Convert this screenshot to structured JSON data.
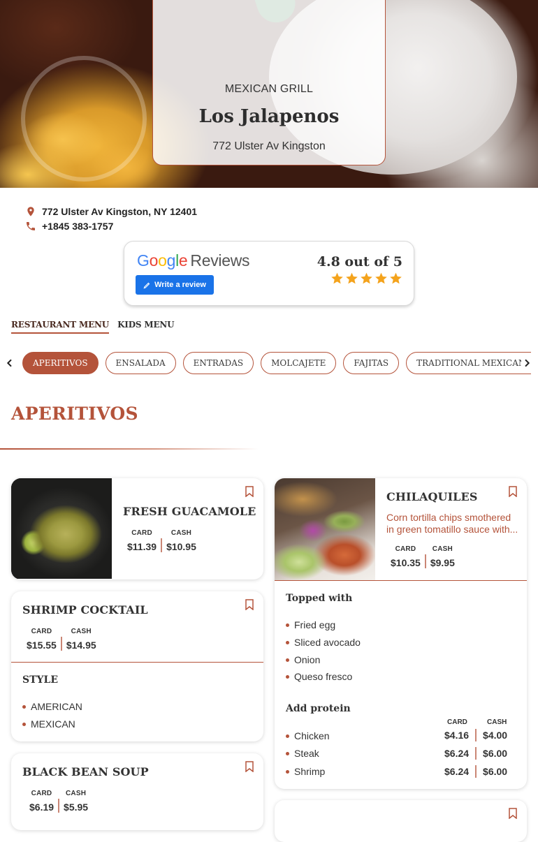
{
  "hero": {
    "subtitle": "MEXICAN GRILL",
    "title": "Los Jalapenos",
    "address": "772 Ulster Av Kingston",
    "address_glyph": ""
  },
  "contact": {
    "address": "772 Ulster Av Kingston, NY 12401",
    "phone": "+1845 383-1757"
  },
  "reviews": {
    "brand": "Google",
    "label": "Reviews",
    "button": "Write a review",
    "score": "4.8 out of 5",
    "stars": 5,
    "star_color": "#f4a31c"
  },
  "menu_tabs": [
    "RESTAURANT MENU",
    "KIDS MENU"
  ],
  "categories": [
    "APERITIVOS",
    "ENSALADA",
    "ENTRADAS",
    "MOLCAJETE",
    "FAJITAS",
    "TRADITIONAL MEXICAN TACOS"
  ],
  "section_title": "APERITIVOS",
  "price_labels": {
    "card": "CARD",
    "cash": "CASH"
  },
  "items": {
    "guacamole": {
      "name": "FRESH GUACAMOLE",
      "card": "$11.39",
      "cash": "$10.95"
    },
    "shrimp": {
      "name": "SHRIMP COCKTAIL",
      "card": "$15.55",
      "cash": "$14.95",
      "option_title": "STYLE",
      "options": [
        "AMERICAN",
        "MEXICAN"
      ]
    },
    "soup": {
      "name": "BLACK BEAN SOUP",
      "card": "$6.19",
      "cash": "$5.95"
    },
    "chilaquiles": {
      "name": "CHILAQUILES",
      "description_line1": "Corn tortilla chips smothered",
      "description_line2": "in green tomatillo sauce with...",
      "card": "$10.35",
      "cash": "$9.95",
      "toppings_title": "Topped with",
      "toppings": [
        "Fried egg",
        "Sliced avocado",
        "Onion",
        "Queso fresco"
      ],
      "protein_title": "Add protein",
      "proteins": [
        {
          "name": "Chicken",
          "card": "$4.16",
          "cash": "$4.00"
        },
        {
          "name": "Steak",
          "card": "$6.24",
          "cash": "$6.00"
        },
        {
          "name": "Shrimp",
          "card": "$6.24",
          "cash": "$6.00"
        }
      ]
    }
  },
  "colors": {
    "accent": "#b4533a",
    "google_blue": "#1a73e8"
  }
}
